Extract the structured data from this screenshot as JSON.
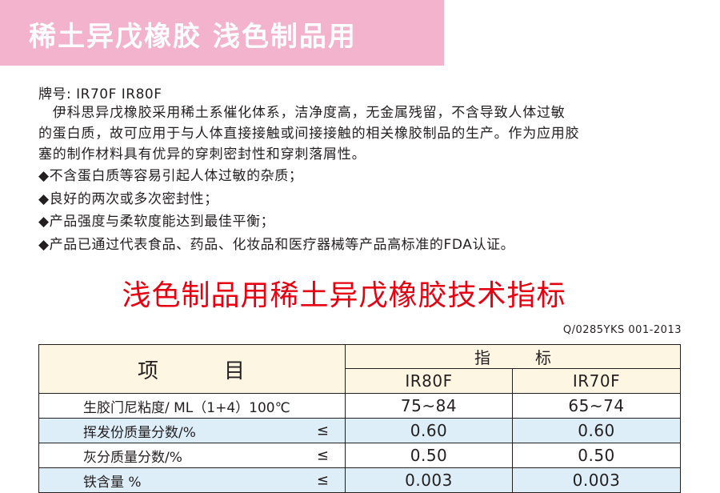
{
  "banner": {
    "title": "稀土异戊橡胶 浅色制品用"
  },
  "brand_line": "牌号: IR70F IR80F",
  "description_lines": [
    "　伊科思异戊橡胶采用稀土系催化体系，洁净度高，无金属残留，不含导致人体过敏",
    "的蛋白质，故可应用于与人体直接接触或间接接触的相关橡胶制品的生产。作为应用胶",
    "塞的制作材料具有优异的穿刺密封性和穿刺落屑性。"
  ],
  "bullets": [
    "◆不含蛋白质等容易引起人体过敏的杂质；",
    "◆良好的两次或多次密封性；",
    "◆产品强度与柔软度能达到最佳平衡；",
    "◆产品已通过代表食品、药品、化妆品和医疗器械等产品高标准的FDA认证。"
  ],
  "section_title": "浅色制品用稀土异戊橡胶技术指标",
  "standard": "Q/0285YKS 001-2013",
  "table": {
    "header_item_a": "项",
    "header_item_b": "目",
    "header_index_a": "指",
    "header_index_b": "标",
    "col_ir80f": "IR80F",
    "col_ir70f": "IR70F",
    "rows": [
      {
        "item": "生胶门尼粘度/ ML（1+4）100℃",
        "cmp": "",
        "ir80f": "75~84",
        "ir70f": "65~74"
      },
      {
        "item": "挥发份质量分数/%",
        "cmp": "≤",
        "ir80f": "0.60",
        "ir70f": "0.60"
      },
      {
        "item": "灰分质量分数/%",
        "cmp": "≤",
        "ir80f": "0.50",
        "ir70f": "0.50"
      },
      {
        "item": "铁含量 %",
        "cmp": "≤",
        "ir80f": "0.003",
        "ir70f": "0.003"
      }
    ]
  },
  "colors": {
    "banner": "#f4b3cd",
    "title_red": "#e60012",
    "header_bg": "#fdf6e3",
    "row_alt": "#ddeef8"
  }
}
